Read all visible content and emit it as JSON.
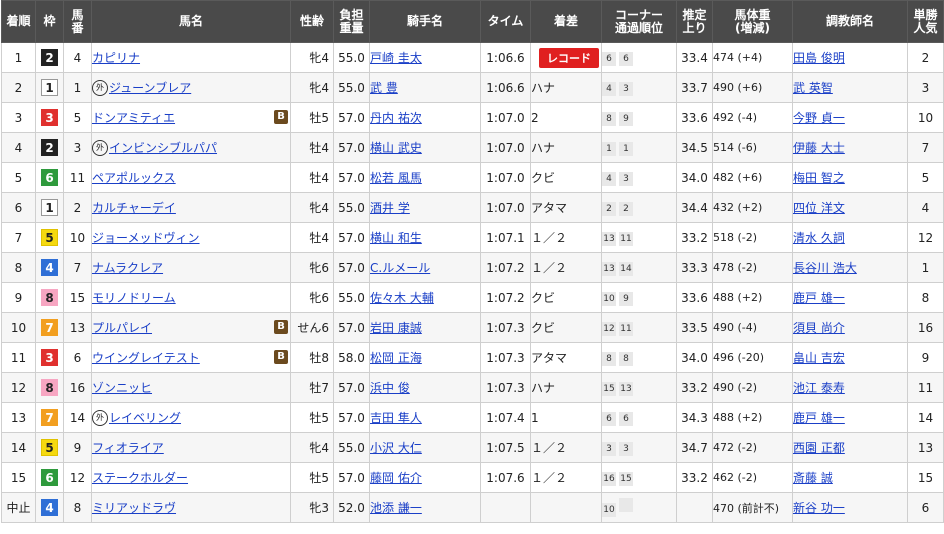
{
  "headers": {
    "rank": "着順",
    "waku": "枠",
    "umaban": "馬\n番",
    "horse": "馬名",
    "sexage": "性齢",
    "weight": "負担\n重量",
    "jockey": "騎手名",
    "time": "タイム",
    "margin": "着差",
    "corner": "コーナー\n通過順位",
    "last3f": "推定\n上り",
    "bodyweight": "馬体重\n(増減)",
    "trainer": "調教師名",
    "pop": "単勝\n人気"
  },
  "record_label": "レコード",
  "foreign_mark": "外",
  "blinker_mark": "B",
  "rows": [
    {
      "rank": "1",
      "waku": "2",
      "umaban": "4",
      "horse": "カピリナ",
      "foreign": false,
      "blinker": false,
      "sexage": "牝4",
      "weight": "55.0",
      "jockey": "戸崎 圭太",
      "time": "1:06.6",
      "margin": "",
      "record": true,
      "c1": "6",
      "c2": "6",
      "last3f": "33.4",
      "bw": "474 (+4)",
      "trainer": "田島 俊明",
      "pop": "2"
    },
    {
      "rank": "2",
      "waku": "1",
      "umaban": "1",
      "horse": "ジューンブレア",
      "foreign": true,
      "blinker": false,
      "sexage": "牝4",
      "weight": "55.0",
      "jockey": "武 豊",
      "time": "1:06.6",
      "margin": "ハナ",
      "record": false,
      "c1": "4",
      "c2": "3",
      "last3f": "33.7",
      "bw": "490 (+6)",
      "trainer": "武 英智",
      "pop": "3"
    },
    {
      "rank": "3",
      "waku": "3",
      "umaban": "5",
      "horse": "ドンアミティエ",
      "foreign": false,
      "blinker": true,
      "sexage": "牡5",
      "weight": "57.0",
      "jockey": "丹内 祐次",
      "time": "1:07.0",
      "margin": "2",
      "record": false,
      "c1": "8",
      "c2": "9",
      "last3f": "33.6",
      "bw": "492 (-4)",
      "trainer": "今野 貞一",
      "pop": "10"
    },
    {
      "rank": "4",
      "waku": "2",
      "umaban": "3",
      "horse": "インビンシブルパパ",
      "foreign": true,
      "blinker": false,
      "sexage": "牡4",
      "weight": "57.0",
      "jockey": "横山 武史",
      "time": "1:07.0",
      "margin": "ハナ",
      "record": false,
      "c1": "1",
      "c2": "1",
      "last3f": "34.5",
      "bw": "514 (-6)",
      "trainer": "伊藤 大士",
      "pop": "7"
    },
    {
      "rank": "5",
      "waku": "6",
      "umaban": "11",
      "horse": "ペアポルックス",
      "foreign": false,
      "blinker": false,
      "sexage": "牡4",
      "weight": "57.0",
      "jockey": "松若 風馬",
      "time": "1:07.0",
      "margin": "クビ",
      "record": false,
      "c1": "4",
      "c2": "3",
      "last3f": "34.0",
      "bw": "482 (+6)",
      "trainer": "梅田 智之",
      "pop": "5"
    },
    {
      "rank": "6",
      "waku": "1",
      "umaban": "2",
      "horse": "カルチャーデイ",
      "foreign": false,
      "blinker": false,
      "sexage": "牝4",
      "weight": "55.0",
      "jockey": "酒井 学",
      "time": "1:07.0",
      "margin": "アタマ",
      "record": false,
      "c1": "2",
      "c2": "2",
      "last3f": "34.4",
      "bw": "432 (+2)",
      "trainer": "四位 洋文",
      "pop": "4"
    },
    {
      "rank": "7",
      "waku": "5",
      "umaban": "10",
      "horse": "ジョーメッドヴィン",
      "foreign": false,
      "blinker": false,
      "sexage": "牡4",
      "weight": "57.0",
      "jockey": "横山 和生",
      "time": "1:07.1",
      "margin": "１／２",
      "record": false,
      "c1": "13",
      "c2": "11",
      "last3f": "33.2",
      "bw": "518 (-2)",
      "trainer": "清水 久詞",
      "pop": "12"
    },
    {
      "rank": "8",
      "waku": "4",
      "umaban": "7",
      "horse": "ナムラクレア",
      "foreign": false,
      "blinker": false,
      "sexage": "牝6",
      "weight": "57.0",
      "jockey": "C.ルメール",
      "time": "1:07.2",
      "margin": "１／２",
      "record": false,
      "c1": "13",
      "c2": "14",
      "last3f": "33.3",
      "bw": "478 (-2)",
      "trainer": "長谷川 浩大",
      "pop": "1"
    },
    {
      "rank": "9",
      "waku": "8",
      "umaban": "15",
      "horse": "モリノドリーム",
      "foreign": false,
      "blinker": false,
      "sexage": "牝6",
      "weight": "55.0",
      "jockey": "佐々木 大輔",
      "time": "1:07.2",
      "margin": "クビ",
      "record": false,
      "c1": "10",
      "c2": "9",
      "last3f": "33.6",
      "bw": "488 (+2)",
      "trainer": "鹿戸 雄一",
      "pop": "8"
    },
    {
      "rank": "10",
      "waku": "7",
      "umaban": "13",
      "horse": "プルパレイ",
      "foreign": false,
      "blinker": true,
      "sexage": "せん6",
      "weight": "57.0",
      "jockey": "岩田 康誠",
      "time": "1:07.3",
      "margin": "クビ",
      "record": false,
      "c1": "12",
      "c2": "11",
      "last3f": "33.5",
      "bw": "490 (-4)",
      "trainer": "須貝 尚介",
      "pop": "16"
    },
    {
      "rank": "11",
      "waku": "3",
      "umaban": "6",
      "horse": "ウイングレイテスト",
      "foreign": false,
      "blinker": true,
      "sexage": "牡8",
      "weight": "58.0",
      "jockey": "松岡 正海",
      "time": "1:07.3",
      "margin": "アタマ",
      "record": false,
      "c1": "8",
      "c2": "8",
      "last3f": "34.0",
      "bw": "496 (-20)",
      "trainer": "畠山 吉宏",
      "pop": "9"
    },
    {
      "rank": "12",
      "waku": "8",
      "umaban": "16",
      "horse": "ゾンニッヒ",
      "foreign": false,
      "blinker": false,
      "sexage": "牡7",
      "weight": "57.0",
      "jockey": "浜中 俊",
      "time": "1:07.3",
      "margin": "ハナ",
      "record": false,
      "c1": "15",
      "c2": "13",
      "last3f": "33.2",
      "bw": "490 (-2)",
      "trainer": "池江 泰寿",
      "pop": "11"
    },
    {
      "rank": "13",
      "waku": "7",
      "umaban": "14",
      "horse": "レイベリング",
      "foreign": true,
      "blinker": false,
      "sexage": "牡5",
      "weight": "57.0",
      "jockey": "吉田 隼人",
      "time": "1:07.4",
      "margin": "1",
      "record": false,
      "c1": "6",
      "c2": "6",
      "last3f": "34.3",
      "bw": "488 (+2)",
      "trainer": "鹿戸 雄一",
      "pop": "14"
    },
    {
      "rank": "14",
      "waku": "5",
      "umaban": "9",
      "horse": "フィオライア",
      "foreign": false,
      "blinker": false,
      "sexage": "牝4",
      "weight": "55.0",
      "jockey": "小沢 大仁",
      "time": "1:07.5",
      "margin": "１／２",
      "record": false,
      "c1": "3",
      "c2": "3",
      "last3f": "34.7",
      "bw": "472 (-2)",
      "trainer": "西園 正都",
      "pop": "13"
    },
    {
      "rank": "15",
      "waku": "6",
      "umaban": "12",
      "horse": "ステークホルダー",
      "foreign": false,
      "blinker": false,
      "sexage": "牡5",
      "weight": "57.0",
      "jockey": "藤岡 佑介",
      "time": "1:07.6",
      "margin": "１／２",
      "record": false,
      "c1": "16",
      "c2": "15",
      "last3f": "33.2",
      "bw": "462 (-2)",
      "trainer": "斎藤 誠",
      "pop": "15"
    },
    {
      "rank": "中止",
      "waku": "4",
      "umaban": "8",
      "horse": "ミリアッドラヴ",
      "foreign": false,
      "blinker": false,
      "sexage": "牝3",
      "weight": "52.0",
      "jockey": "池添 謙一",
      "time": "",
      "margin": "",
      "record": false,
      "c1": "10",
      "c2": "",
      "last3f": "",
      "bw": "470 (前計不)",
      "trainer": "新谷 功一",
      "pop": "6"
    }
  ]
}
